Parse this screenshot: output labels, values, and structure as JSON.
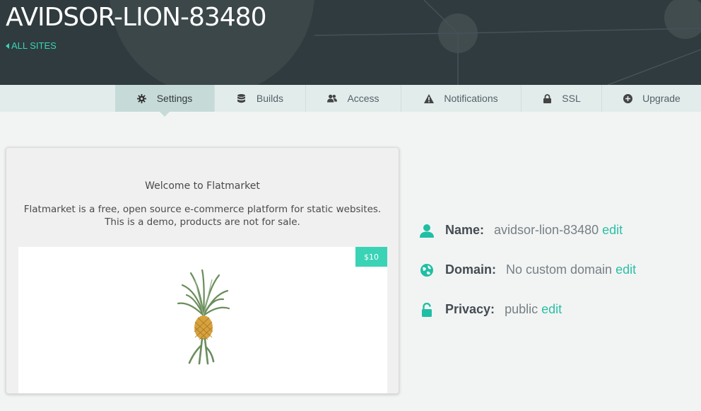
{
  "header": {
    "site_title": "AVIDSOR-LION-83480",
    "back_link": "ALL SITES"
  },
  "tabs": [
    {
      "label": "Settings",
      "icon": "gear-icon"
    },
    {
      "label": "Builds",
      "icon": "database-icon"
    },
    {
      "label": "Access",
      "icon": "users-icon"
    },
    {
      "label": "Notifications",
      "icon": "warning-icon"
    },
    {
      "label": "SSL",
      "icon": "lock-icon"
    },
    {
      "label": "Upgrade",
      "icon": "plus-circle-icon"
    }
  ],
  "active_tab": "Settings",
  "preview": {
    "welcome": "Welcome to Flatmarket",
    "description_line1": "Flatmarket is a free, open source e-commerce platform for static websites.",
    "description_line2": "This is a demo, products are not for sale.",
    "price": "$10",
    "product_image": "pineapple-image"
  },
  "info": {
    "name": {
      "label": "Name:",
      "value": "avidsor-lion-83480",
      "edit": "edit",
      "icon": "user-icon"
    },
    "domain": {
      "label": "Domain:",
      "value": "No custom domain",
      "edit": "edit",
      "icon": "globe-icon"
    },
    "privacy": {
      "label": "Privacy:",
      "value": "public",
      "edit": "edit",
      "icon": "unlock-icon"
    }
  },
  "colors": {
    "header_bg": "#2f3b3e",
    "accent": "#3ad3b6",
    "tab_active_bg": "#c6dbd8",
    "tabbar_bg": "#e2ecea"
  }
}
